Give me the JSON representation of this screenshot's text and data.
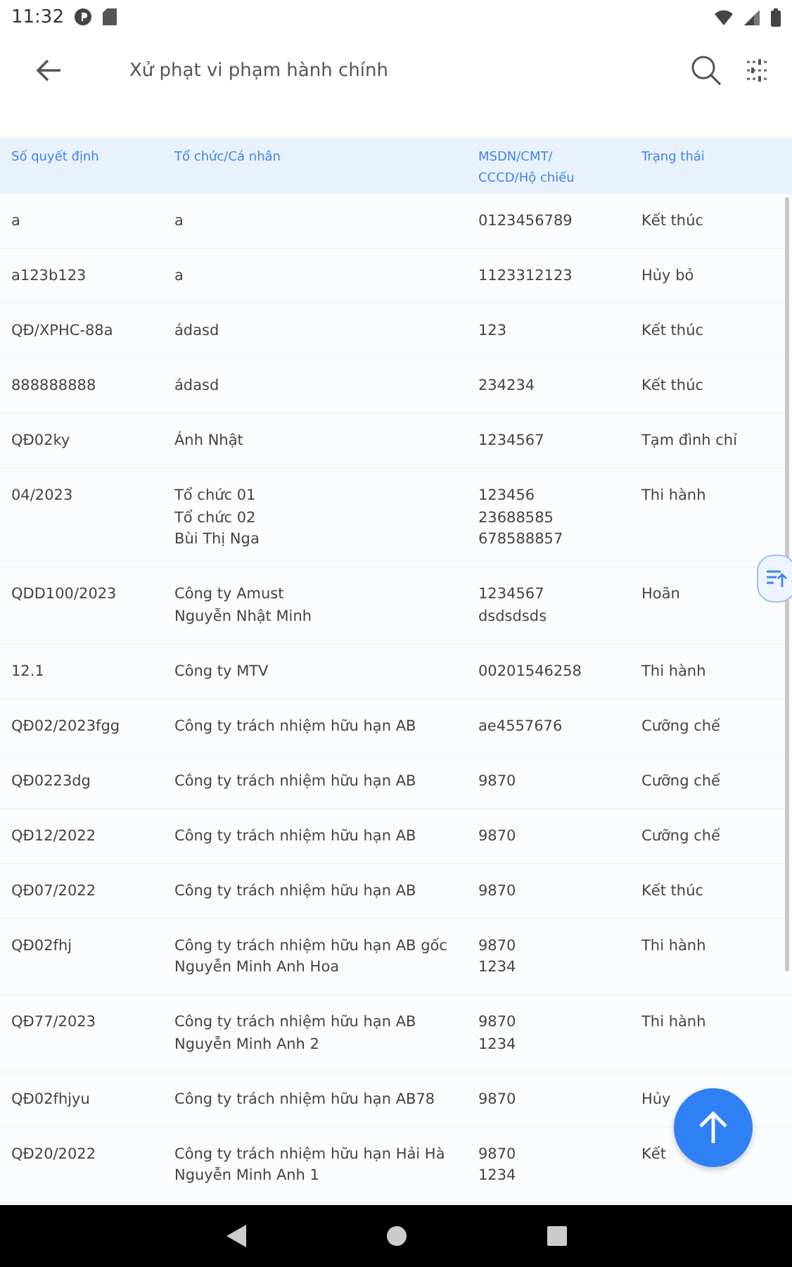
{
  "status_bar": {
    "time": "11:32"
  },
  "app_bar": {
    "title": "Xử phạt vi phạm hành chính"
  },
  "table": {
    "columns": [
      "Số quyết định",
      "Tổ chức/Cá nhân",
      "MSDN/CMT/\nCCCD/Hộ chiếu",
      "Trạng thái"
    ],
    "rows": [
      [
        "a",
        "a",
        "0123456789",
        "Kết thúc"
      ],
      [
        "a123b123",
        "a",
        "1123312123",
        "Hủy bỏ"
      ],
      [
        "QĐ/XPHC-88a",
        "ádasd",
        "123",
        "Kết thúc"
      ],
      [
        "888888888",
        "ádasd",
        "234234",
        "Kết thúc"
      ],
      [
        "QĐ02ky",
        "Ánh Nhật",
        "1234567",
        "Tạm đình chỉ"
      ],
      [
        "04/2023",
        "Tổ chức 01\nTổ chức 02\nBùi Thị Nga",
        "123456\n23688585\n678588857",
        "Thi hành"
      ],
      [
        "QDD100/2023",
        "Công ty Amust\nNguyễn Nhật Minh",
        "1234567\ndsdsdsds",
        "Hoãn"
      ],
      [
        "12.1",
        "Công ty MTV",
        "00201546258",
        "Thi hành"
      ],
      [
        "QĐ02/2023fgg",
        "Công ty trách nhiệm hữu hạn AB",
        "ae4557676",
        "Cưỡng chế"
      ],
      [
        "QĐ0223dg",
        "Công ty trách nhiệm hữu hạn AB",
        "9870",
        "Cưỡng chế"
      ],
      [
        "QĐ12/2022",
        "Công ty trách nhiệm hữu hạn AB",
        "9870",
        "Cưỡng chế"
      ],
      [
        "QĐ07/2022",
        "Công ty trách nhiệm hữu hạn AB",
        "9870",
        "Kết thúc"
      ],
      [
        "QĐ02fhj",
        "Công ty trách nhiệm hữu hạn AB gốc\nNguyễn Minh Anh Hoa",
        "9870\n1234",
        "Thi hành"
      ],
      [
        "QĐ77/2023",
        "Công ty trách nhiệm hữu hạn AB\nNguyễn Minh Anh 2",
        "9870\n1234",
        "Thi hành"
      ],
      [
        "QĐ02fhjyu",
        "Công ty trách nhiệm hữu hạn AB78",
        "9870",
        "Hủy"
      ],
      [
        "QĐ20/2022",
        "Công ty trách nhiệm hữu hạn Hải Hà\nNguyễn Minh Anh 1",
        "9870\n1234",
        "Kết"
      ]
    ]
  }
}
